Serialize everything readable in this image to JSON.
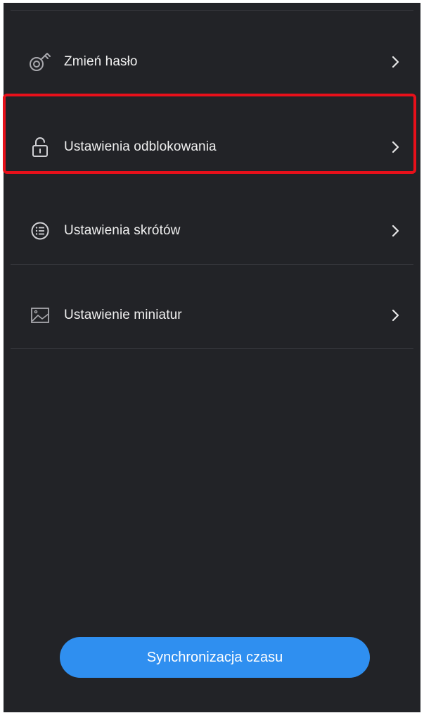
{
  "menu": {
    "items": [
      {
        "label": "Zmień hasło",
        "icon": "key-icon"
      },
      {
        "label": "Ustawienia odblokowania",
        "icon": "unlock-icon"
      },
      {
        "label": "Ustawienia skrótów",
        "icon": "list-icon"
      },
      {
        "label": "Ustawienie miniatur",
        "icon": "image-icon"
      }
    ]
  },
  "sync_button": {
    "label": "Synchronizacja czasu"
  },
  "colors": {
    "background": "#222327",
    "accent": "#2f8ff0",
    "highlight_border": "#e8101a",
    "divider": "#3a3b40"
  }
}
